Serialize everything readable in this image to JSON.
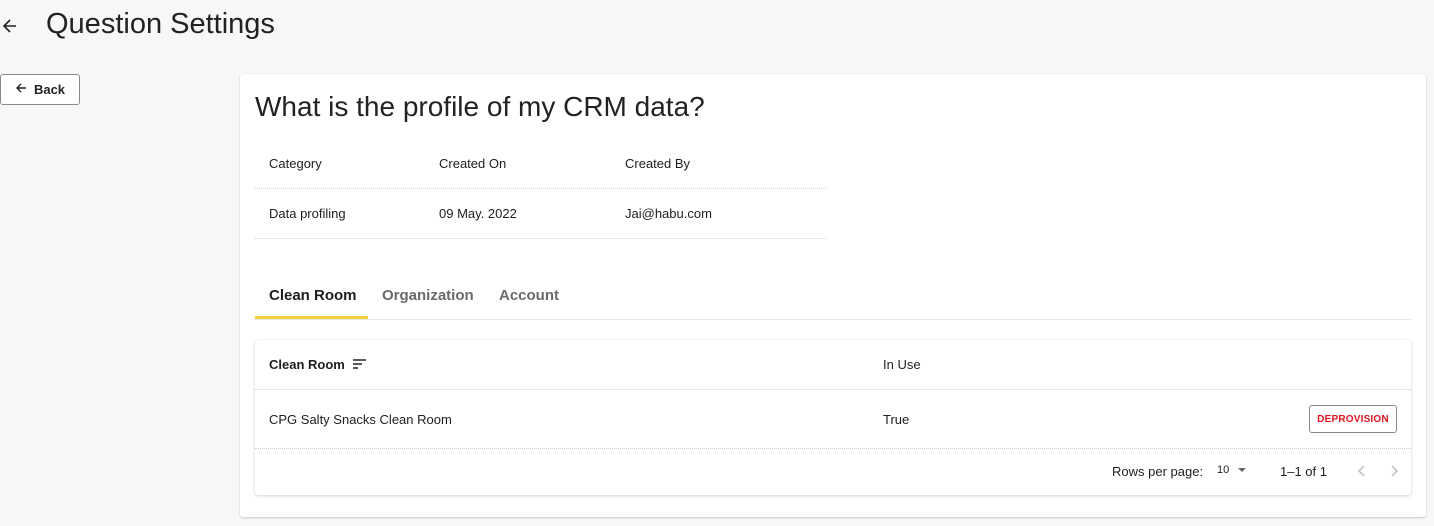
{
  "header": {
    "title": "Question Settings",
    "back_icon": "arrow-left-icon"
  },
  "back_button": {
    "label": "Back",
    "icon": "arrow-left-icon"
  },
  "question": {
    "title": "What is the profile of my CRM data?",
    "meta_headers": [
      "Category",
      "Created On",
      "Created By"
    ],
    "meta_values": [
      "Data profiling",
      "09 May. 2022",
      "Jai@habu.com"
    ]
  },
  "tabs": [
    {
      "label": "Clean Room",
      "active": true
    },
    {
      "label": "Organization",
      "active": false
    },
    {
      "label": "Account",
      "active": false
    }
  ],
  "table": {
    "columns": [
      "Clean Room",
      "In Use"
    ],
    "sort_icon": "sort-icon",
    "rows": [
      {
        "clean_room": "CPG Salty Snacks Clean Room",
        "in_use": "True",
        "action": "DEPROVISION"
      }
    ]
  },
  "pagination": {
    "rows_per_page_label": "Rows per page:",
    "rows_per_page": "10",
    "range": "1–1 of 1"
  },
  "colors": {
    "accent": "#f5d142",
    "danger": "#e0141e",
    "background": "#f7f7f7"
  }
}
